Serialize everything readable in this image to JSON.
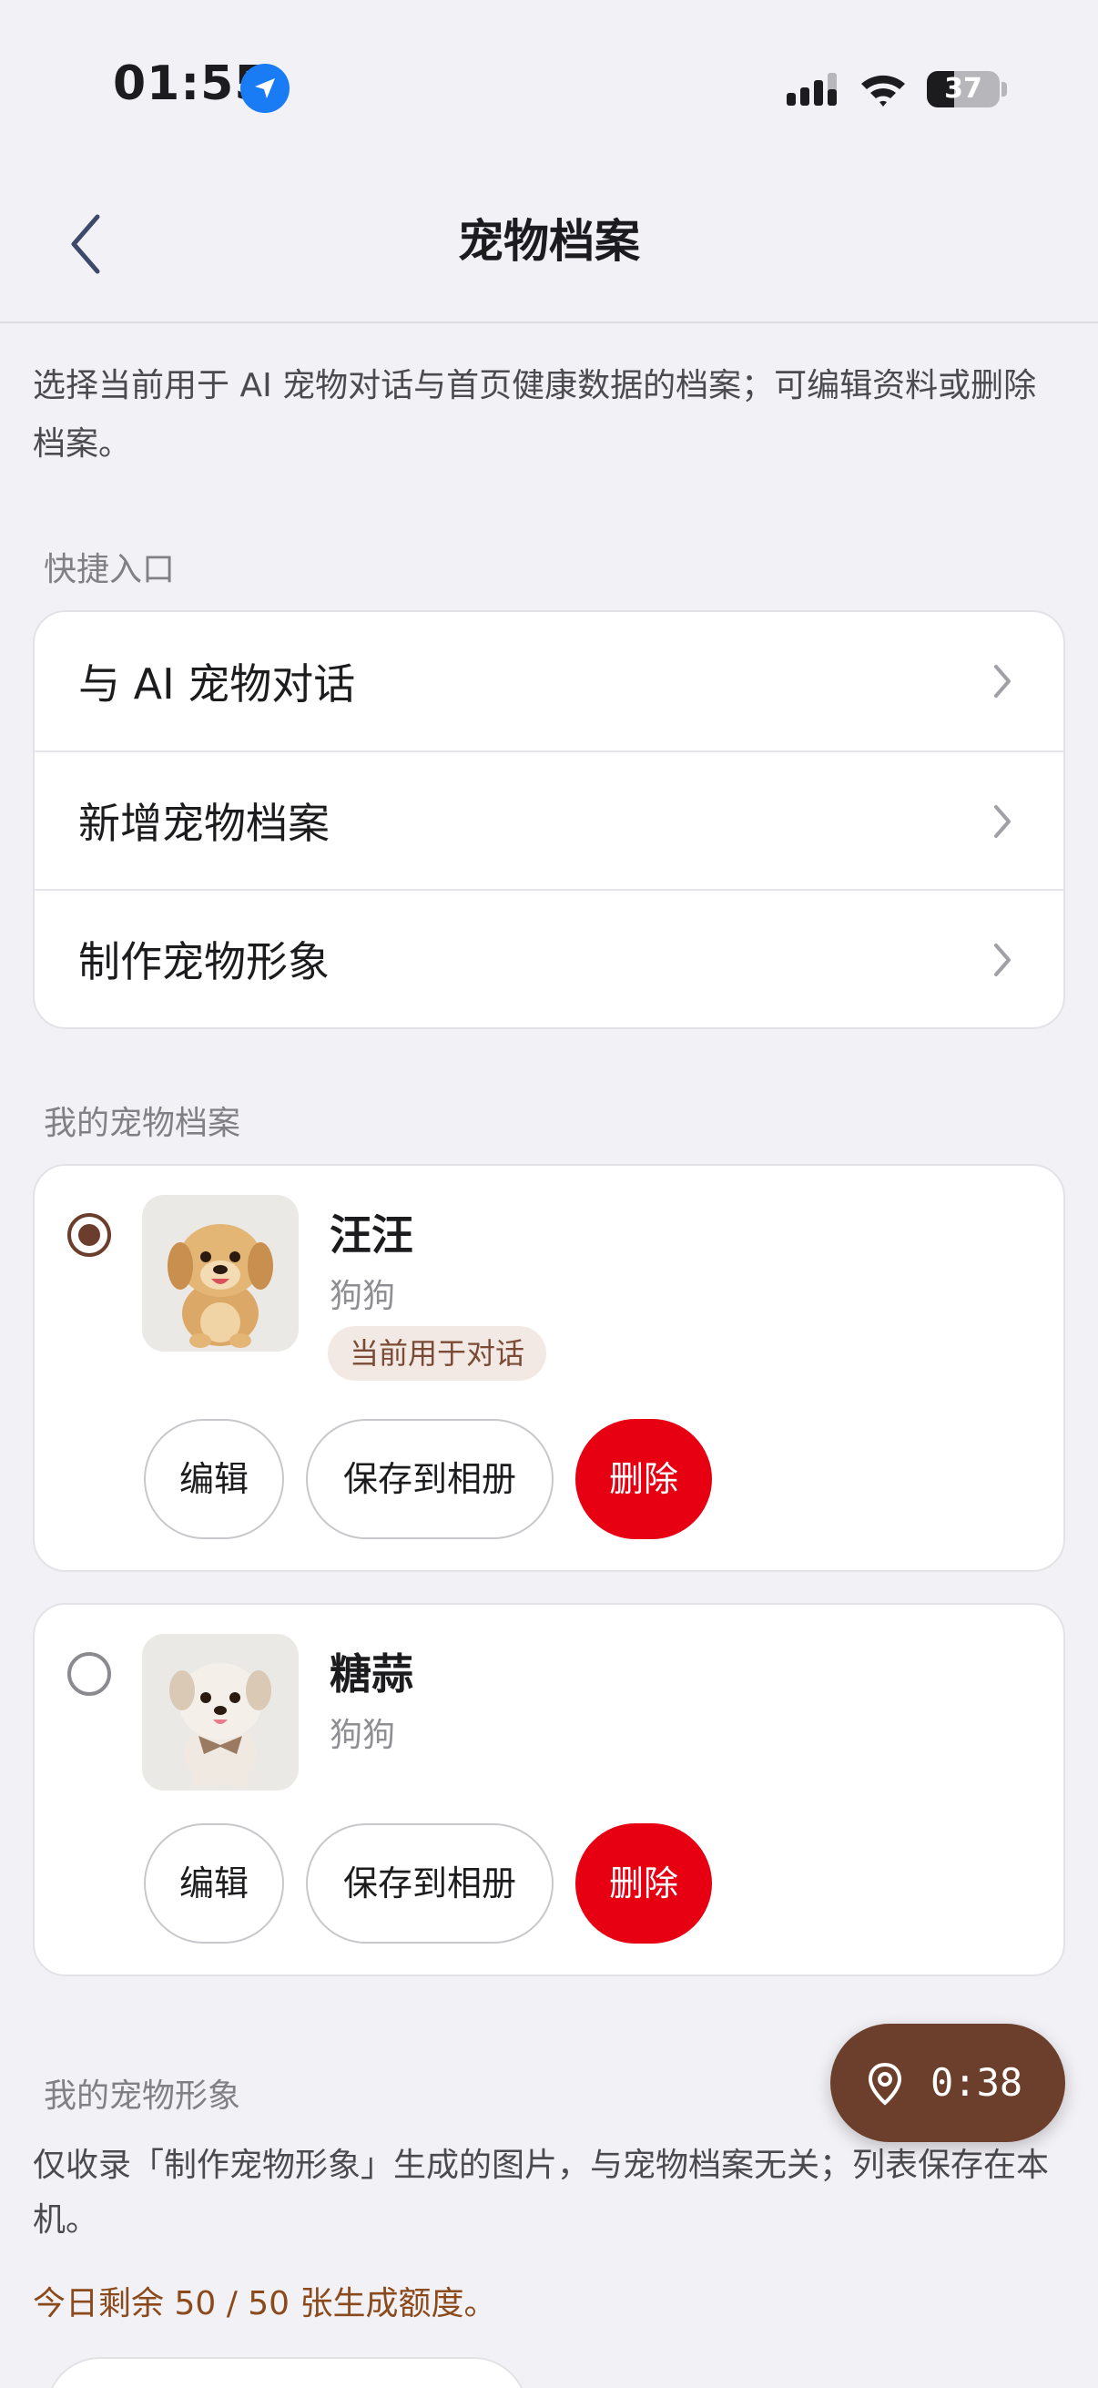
{
  "status_bar": {
    "time": "01:55",
    "battery": "37",
    "battery_level": 0.37
  },
  "nav": {
    "title": "宠物档案"
  },
  "intro": "选择当前用于 AI 宠物对话与首页健康数据的档案；可编辑资料或删除档案。",
  "quick_section": {
    "title": "快捷入口",
    "items": [
      {
        "label": "与 AI 宠物对话"
      },
      {
        "label": "新增宠物档案"
      },
      {
        "label": "制作宠物形象"
      }
    ]
  },
  "pets_section": {
    "title": "我的宠物档案",
    "pets": [
      {
        "name": "汪汪",
        "species": "狗狗",
        "selected": true,
        "badge": "当前用于对话",
        "edit_label": "编辑",
        "save_label": "保存到相册",
        "delete_label": "删除"
      },
      {
        "name": "糖蒜",
        "species": "狗狗",
        "selected": false,
        "edit_label": "编辑",
        "save_label": "保存到相册",
        "delete_label": "删除"
      }
    ]
  },
  "images_section": {
    "title": "我的宠物形象",
    "note": "仅收录「制作宠物形象」生成的图片，与宠物档案无关；列表保存在本机。",
    "quota": "今日剩余 50 / 50 张生成额度。"
  },
  "floating_button": {
    "time": "0:38",
    "icon": "location-pin-icon"
  },
  "colors": {
    "accent_brown": "#6b3f2c",
    "delete_red": "#e60012",
    "quota_text": "#8b4a1c",
    "background": "#f2f1f6"
  }
}
